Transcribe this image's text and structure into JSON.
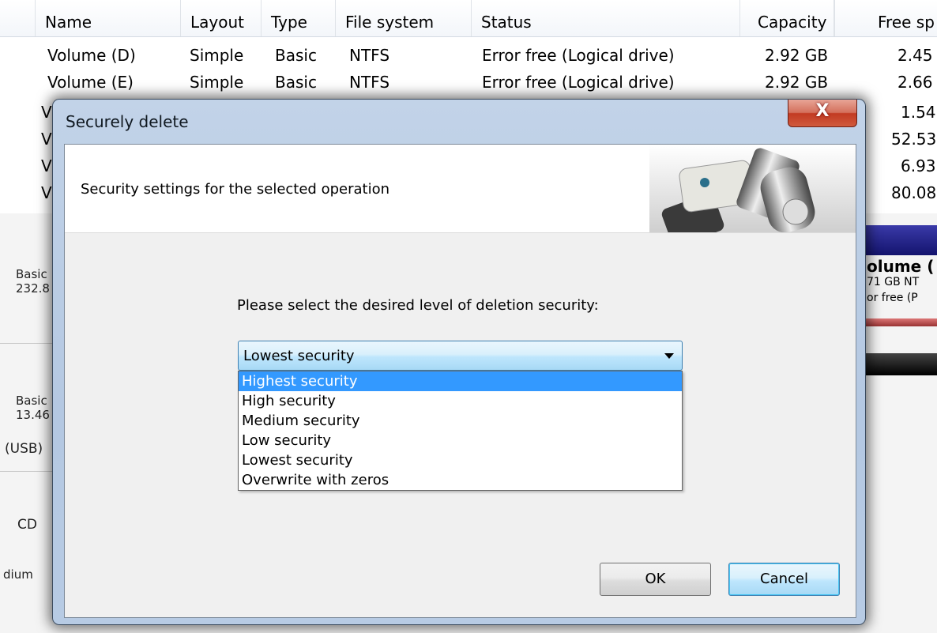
{
  "volume_table": {
    "columns": [
      "Name",
      "Layout",
      "Type",
      "File system",
      "Status",
      "Capacity",
      "Free sp"
    ],
    "rows": [
      [
        "Volume (D)",
        "Simple",
        "Basic",
        "NTFS",
        "Error free (Logical drive)",
        "2.92 GB",
        "2.45"
      ],
      [
        "Volume (E)",
        "Simple",
        "Basic",
        "NTFS",
        "Error free (Logical drive)",
        "2.92 GB",
        "2.66"
      ]
    ],
    "partial_rows": [
      {
        "name": "V",
        "free": "1.54"
      },
      {
        "name": "V",
        "free": "52.53"
      },
      {
        "name": "V",
        "free": "6.93"
      },
      {
        "name": "V",
        "free": "80.08"
      }
    ]
  },
  "disk_panel": {
    "disk0": {
      "type": "Basic",
      "size": "232.8"
    },
    "disk1": {
      "type": "Basic",
      "size": "13.46",
      "bus": "(USB)"
    },
    "cd": "CD",
    "medium": "dium",
    "right_volume": {
      "name": "olume (",
      "size": "71 GB NT",
      "status": "or free (P"
    }
  },
  "dialog": {
    "title": "Securely delete",
    "close_label": "X",
    "banner_text": "Security settings for the selected operation",
    "prompt": "Please select the desired level of deletion security:",
    "selected_value": "Lowest security",
    "options": [
      "Highest security",
      "High security",
      "Medium security",
      "Low security",
      "Lowest security",
      "Overwrite with zeros"
    ],
    "highlighted_option": "Highest security",
    "ok_label": "OK",
    "cancel_label": "Cancel"
  },
  "colors": {
    "highlight": "#3399ff",
    "combo_border": "#3c7fb1",
    "close_red": "#c23a22",
    "right_bar_blue": "#1a1a8c"
  }
}
